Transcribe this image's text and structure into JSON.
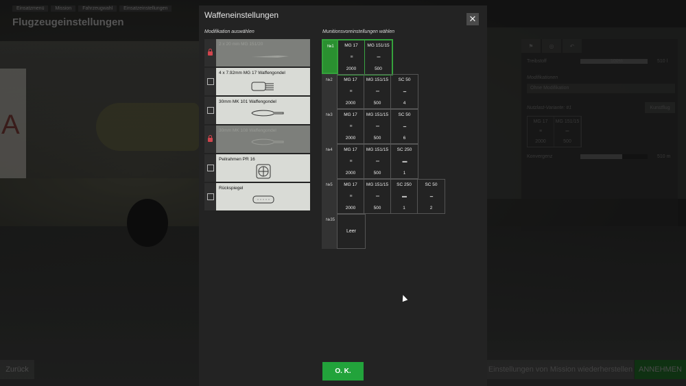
{
  "page": {
    "title": "Flugzeugeinstellungen",
    "breadcrumbs": [
      "Einsatzmenü",
      "Mission",
      "Fahrzeugwahl",
      "Einsatzeinstellungen"
    ],
    "back_label": "Zurück",
    "restore_label": "Einstellungen von Mission wiederherstellen",
    "accept_label": "ANNEHMEN"
  },
  "side_panel": {
    "tabs": [
      "⚑",
      "◎",
      "↶"
    ],
    "fuel_label": "Treibstoff",
    "fuel_percent": "100%",
    "fuel_amount": "510 l",
    "modifications_label": "Modifikationen",
    "modification_value": "Ohne Modifikation",
    "payload_label": "Nutzlast-Variante: #1",
    "payload_button": "Kunstflug",
    "payload_cells": [
      {
        "name": "MG 17",
        "count": "2000"
      },
      {
        "name": "MG 151/15",
        "count": "500"
      }
    ],
    "convergence_label": "Konvergenz",
    "convergence_value": "510 m"
  },
  "dialog": {
    "title": "Waffeneinstellungen",
    "close_label": "✕",
    "mods_heading": "Modifikation auswählen",
    "presets_heading": "Munitionsvoreinstellungen wählen",
    "ok_label": "O. K.",
    "mods": [
      {
        "name": "2 x 20 mm MG 151/20",
        "locked": true,
        "icon": "cannon-icon"
      },
      {
        "name": "4 x 7.92mm MG 17 Waffengondel",
        "locked": false,
        "icon": "gun-pod-icon"
      },
      {
        "name": "30mm MK 101 Waffengondel",
        "locked": false,
        "icon": "cannon-pod-icon"
      },
      {
        "name": "30mm MK 108 Waffengondel",
        "locked": true,
        "icon": "cannon-pod-icon"
      },
      {
        "name": "Peilrahmen PR 16",
        "locked": false,
        "icon": "direction-finder-icon"
      },
      {
        "name": "Rückspiegel",
        "locked": false,
        "icon": "mirror-icon"
      }
    ],
    "presets": [
      {
        "num": "№1",
        "selected": true,
        "items": [
          {
            "name": "MG 17",
            "sym": "≡",
            "count": "2000"
          },
          {
            "name": "MG 151/15",
            "sym": "═",
            "count": "500"
          }
        ]
      },
      {
        "num": "№2",
        "selected": false,
        "items": [
          {
            "name": "MG 17",
            "sym": "≡",
            "count": "2000"
          },
          {
            "name": "MG 151/15",
            "sym": "═",
            "count": "500"
          },
          {
            "name": "SC 50",
            "sym": "━",
            "count": "4"
          }
        ]
      },
      {
        "num": "№3",
        "selected": false,
        "items": [
          {
            "name": "MG 17",
            "sym": "≡",
            "count": "2000"
          },
          {
            "name": "MG 151/15",
            "sym": "═",
            "count": "500"
          },
          {
            "name": "SC 50",
            "sym": "━",
            "count": "6"
          }
        ]
      },
      {
        "num": "№4",
        "selected": false,
        "items": [
          {
            "name": "MG 17",
            "sym": "≡",
            "count": "2000"
          },
          {
            "name": "MG 151/15",
            "sym": "═",
            "count": "500"
          },
          {
            "name": "SC 250",
            "sym": "▬",
            "count": "1"
          }
        ]
      },
      {
        "num": "№5",
        "selected": false,
        "items": [
          {
            "name": "MG 17",
            "sym": "≡",
            "count": "2000"
          },
          {
            "name": "MG 151/15",
            "sym": "═",
            "count": "500"
          },
          {
            "name": "SC 250",
            "sym": "▬",
            "count": "1"
          },
          {
            "name": "SC 50",
            "sym": "━",
            "count": "2"
          }
        ]
      },
      {
        "num": "№35",
        "selected": false,
        "empty_label": "Leer",
        "items": []
      }
    ]
  },
  "colors": {
    "accent_green": "#22a33b",
    "lock_red": "#d2454d"
  }
}
